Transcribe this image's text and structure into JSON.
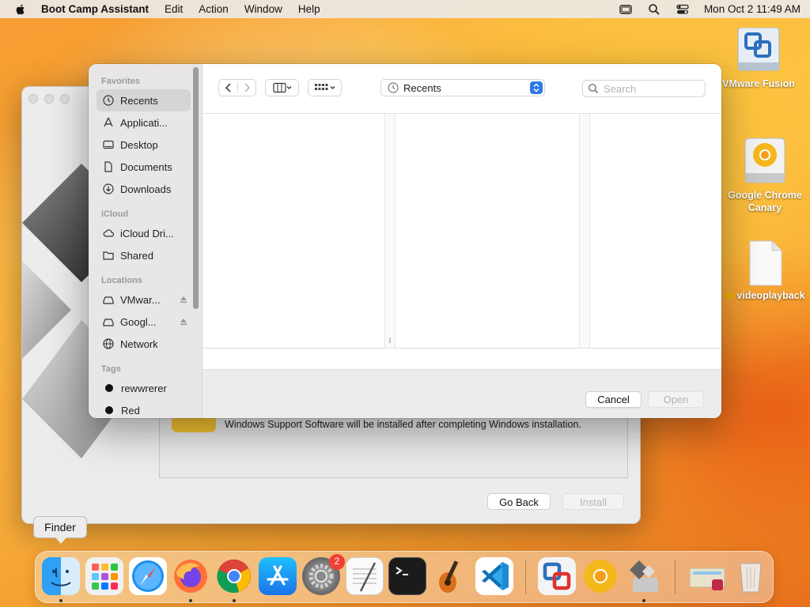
{
  "menubar": {
    "app_name": "Boot Camp Assistant",
    "items": [
      "Edit",
      "Action",
      "Window",
      "Help"
    ],
    "datetime": "Mon Oct 2  11:49 AM"
  },
  "desktop": {
    "icons": [
      {
        "label": "VMware Fusion",
        "icon": "vmware-fusion-volume-icon"
      },
      {
        "label": "Google Chrome Canary",
        "icon": "chrome-canary-disk-icon"
      },
      {
        "label": "videoplayback",
        "icon": "document-icon",
        "tag_color": "#f0b400"
      }
    ]
  },
  "bootcamp": {
    "info_text": "Windows Support Software will be installed after completing Windows installation.",
    "go_back_label": "Go Back",
    "install_label": "Install"
  },
  "open_panel": {
    "sidebar": {
      "favorites_header": "Favorites",
      "favorites": [
        "Recents",
        "Applicati...",
        "Desktop",
        "Documents",
        "Downloads"
      ],
      "icloud_header": "iCloud",
      "icloud": [
        "iCloud Dri...",
        "Shared"
      ],
      "locations_header": "Locations",
      "locations": [
        "VMwar...",
        "Googl...",
        "Network"
      ],
      "tags_header": "Tags",
      "tags": [
        "rewwrerer",
        "Red"
      ]
    },
    "location": "Recents",
    "search_placeholder": "Search",
    "cancel_label": "Cancel",
    "open_label": "Open"
  },
  "dock": {
    "tooltip": "Finder",
    "settings_badge": "2",
    "apps": [
      "Finder",
      "Launchpad",
      "Safari",
      "Firefox",
      "Google Chrome",
      "App Store",
      "System Settings",
      "TextEdit",
      "Terminal",
      "GarageBand",
      "Visual Studio Code",
      "VMware Fusion",
      "Google Chrome Canary",
      "Boot Camp Assistant",
      "Downloads",
      "Trash"
    ]
  },
  "colors": {
    "accent": "#2f7ae5",
    "badge": "#f04035"
  }
}
